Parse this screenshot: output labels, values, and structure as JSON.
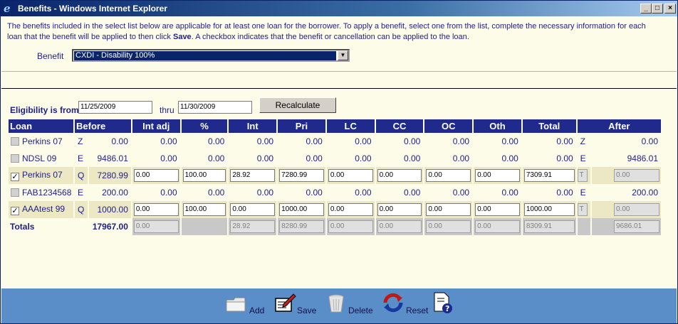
{
  "window": {
    "title": "Benefits - Windows Internet Explorer"
  },
  "intro": {
    "text_part1": "The benefits included in the select list below are applicable for at least one loan for the borrower. To apply a benefit, select one from the list, complete the necessary information for each loan that the benefit will be applied to then click ",
    "bold": "Save",
    "text_part2": ". A checkbox indicates that the benefit or cancellation can be applied to the loan."
  },
  "benefit": {
    "label": "Benefit",
    "selected": "CXDI - Disability 100%"
  },
  "eligibility": {
    "label": "Eligibility is from",
    "from": "11/25/2009",
    "thru_label": "thru",
    "thru": "11/30/2009",
    "recalc_label": "Recalculate"
  },
  "table": {
    "headers": [
      "Loan",
      "Before",
      "Int adj",
      "%",
      "Int",
      "Pri",
      "LC",
      "CC",
      "OC",
      "Oth",
      "Total",
      "After"
    ],
    "rows": [
      {
        "checked": false,
        "loan": "Perkins 07",
        "code": "Z",
        "before": "0.00",
        "int_adj": "0.00",
        "pct": "0.00",
        "int": "0.00",
        "pri": "0.00",
        "lc": "0.00",
        "cc": "0.00",
        "oc": "0.00",
        "oth": "0.00",
        "total": "0.00",
        "after_code": "Z",
        "after": "0.00"
      },
      {
        "checked": false,
        "loan": "NDSL 09",
        "code": "E",
        "before": "9486.01",
        "int_adj": "0.00",
        "pct": "0.00",
        "int": "0.00",
        "pri": "0.00",
        "lc": "0.00",
        "cc": "0.00",
        "oc": "0.00",
        "oth": "0.00",
        "total": "0.00",
        "after_code": "E",
        "after": "9486.01"
      },
      {
        "checked": true,
        "loan": "Perkins 07",
        "code": "Q",
        "before": "7280.99",
        "int_adj": "0.00",
        "pct": "100.00",
        "int": "28.92",
        "pri": "7280.99",
        "lc": "0.00",
        "cc": "0.00",
        "oc": "0.00",
        "oth": "0.00",
        "total": "7309.91",
        "after_code": "T",
        "after": "0.00"
      },
      {
        "checked": false,
        "loan": "FAB1234568",
        "code": "E",
        "before": "200.00",
        "int_adj": "0.00",
        "pct": "0.00",
        "int": "0.00",
        "pri": "0.00",
        "lc": "0.00",
        "cc": "0.00",
        "oc": "0.00",
        "oth": "0.00",
        "total": "0.00",
        "after_code": "E",
        "after": "200.00"
      },
      {
        "checked": true,
        "loan": "AAAtest 99",
        "code": "Q",
        "before": "1000.00",
        "int_adj": "0.00",
        "pct": "100.00",
        "int": "0.00",
        "pri": "1000.00",
        "lc": "0.00",
        "cc": "0.00",
        "oc": "0.00",
        "oth": "0.00",
        "total": "1000.00",
        "after_code": "T",
        "after": "0.00"
      }
    ],
    "totals": {
      "label": "Totals",
      "before": "17967.00",
      "int_adj": "0.00",
      "int": "28.92",
      "pri": "8280.99",
      "lc": "0.00",
      "cc": "0.00",
      "oc": "0.00",
      "oth": "0.00",
      "total": "8309.91",
      "after": "9686.01"
    }
  },
  "toolbar": {
    "add": "Add",
    "save": "Save",
    "delete": "Delete",
    "reset": "Reset"
  }
}
